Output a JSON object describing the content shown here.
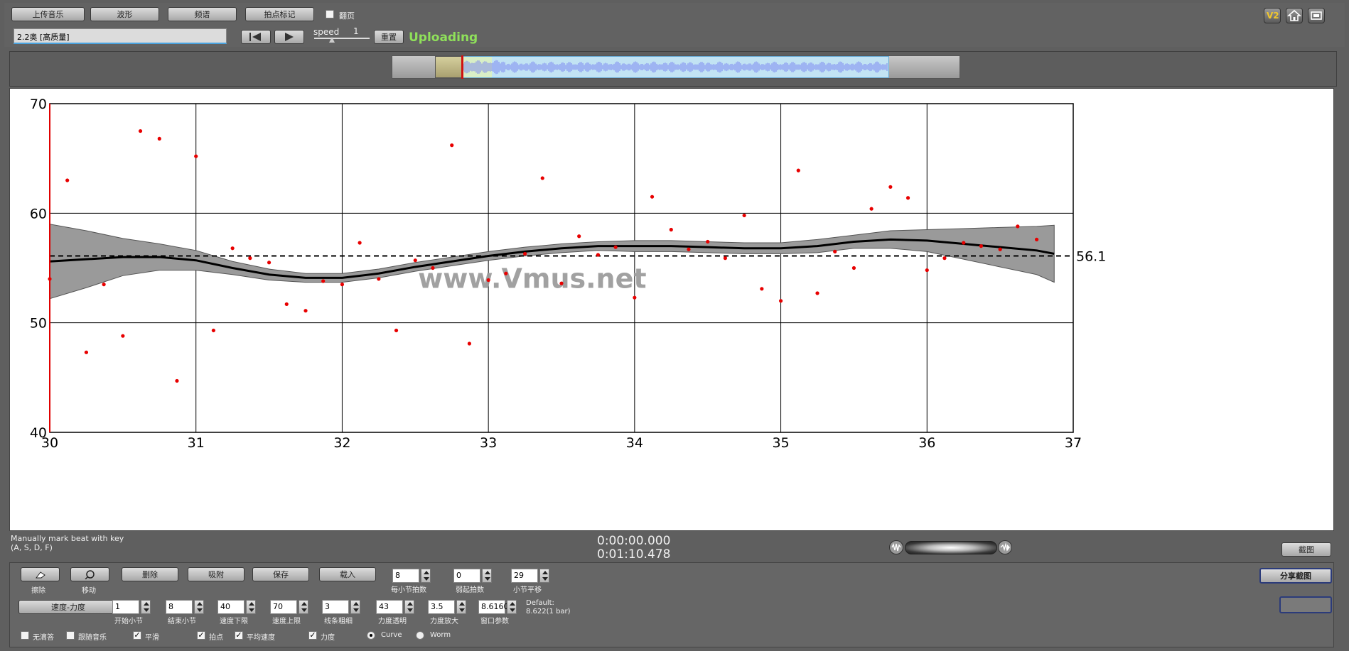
{
  "toolbar": {
    "upload_music": "上传音乐",
    "waveform": "波形",
    "spectrum": "频谱",
    "beat_mark": "拍点标记",
    "flip_label": "翻页",
    "file_name": "2.2奥 [高质量]",
    "speed_label": "speed",
    "speed_value": "1",
    "reset": "重置",
    "status": "Uploading"
  },
  "top_right_icons": [
    "v2-icon",
    "home-icon",
    "window-icon"
  ],
  "v2_label": "V2",
  "chart_data": {
    "type": "scatter",
    "x_ticks": [
      "30",
      "31",
      "32",
      "33",
      "34",
      "35",
      "36",
      "37"
    ],
    "y_ticks": [
      "40",
      "50",
      "60",
      "70"
    ],
    "xlim": [
      30,
      37
    ],
    "ylim": [
      40,
      70
    ],
    "grid": true,
    "watermark": "www.Vmus.net",
    "mean_value": 56.1,
    "mean_label": "56.1",
    "points": [
      [
        30.0,
        54.0
      ],
      [
        30.12,
        63.0
      ],
      [
        30.25,
        47.3
      ],
      [
        30.37,
        53.5
      ],
      [
        30.5,
        48.8
      ],
      [
        30.62,
        67.5
      ],
      [
        30.75,
        66.8
      ],
      [
        30.87,
        44.7
      ],
      [
        31.0,
        65.2
      ],
      [
        31.12,
        49.3
      ],
      [
        31.25,
        56.8
      ],
      [
        31.37,
        55.9
      ],
      [
        31.5,
        55.5
      ],
      [
        31.62,
        51.7
      ],
      [
        31.75,
        51.1
      ],
      [
        31.87,
        53.8
      ],
      [
        32.0,
        53.5
      ],
      [
        32.12,
        57.3
      ],
      [
        32.25,
        54.0
      ],
      [
        32.37,
        49.3
      ],
      [
        32.5,
        55.7
      ],
      [
        32.62,
        55.0
      ],
      [
        32.75,
        66.2
      ],
      [
        32.87,
        48.1
      ],
      [
        33.0,
        53.9
      ],
      [
        33.12,
        54.5
      ],
      [
        33.25,
        56.3
      ],
      [
        33.37,
        63.2
      ],
      [
        33.5,
        53.6
      ],
      [
        33.62,
        57.9
      ],
      [
        33.75,
        56.2
      ],
      [
        33.87,
        56.9
      ],
      [
        34.0,
        52.3
      ],
      [
        34.12,
        61.5
      ],
      [
        34.25,
        58.5
      ],
      [
        34.37,
        56.7
      ],
      [
        34.5,
        57.4
      ],
      [
        34.62,
        55.9
      ],
      [
        34.75,
        59.8
      ],
      [
        34.87,
        53.1
      ],
      [
        35.0,
        52.0
      ],
      [
        35.12,
        63.9
      ],
      [
        35.25,
        52.7
      ],
      [
        35.37,
        56.5
      ],
      [
        35.5,
        55.0
      ],
      [
        35.62,
        60.4
      ],
      [
        35.75,
        62.4
      ],
      [
        35.87,
        61.4
      ],
      [
        36.0,
        54.8
      ],
      [
        36.12,
        55.9
      ],
      [
        36.25,
        57.3
      ],
      [
        36.37,
        57.0
      ],
      [
        36.5,
        56.7
      ],
      [
        36.62,
        58.8
      ],
      [
        36.75,
        57.6
      ]
    ],
    "smooth_curve": [
      [
        30.0,
        55.6
      ],
      [
        30.25,
        55.8
      ],
      [
        30.5,
        56.0
      ],
      [
        30.75,
        56.0
      ],
      [
        31.0,
        55.7
      ],
      [
        31.25,
        55.0
      ],
      [
        31.5,
        54.4
      ],
      [
        31.75,
        54.1
      ],
      [
        32.0,
        54.1
      ],
      [
        32.25,
        54.5
      ],
      [
        32.5,
        55.1
      ],
      [
        32.75,
        55.6
      ],
      [
        33.0,
        56.1
      ],
      [
        33.25,
        56.5
      ],
      [
        33.5,
        56.8
      ],
      [
        33.75,
        57.0
      ],
      [
        34.0,
        57.0
      ],
      [
        34.25,
        57.0
      ],
      [
        34.5,
        56.9
      ],
      [
        34.75,
        56.8
      ],
      [
        35.0,
        56.8
      ],
      [
        35.25,
        57.0
      ],
      [
        35.5,
        57.4
      ],
      [
        35.75,
        57.6
      ],
      [
        36.0,
        57.5
      ],
      [
        36.25,
        57.2
      ],
      [
        36.5,
        56.9
      ],
      [
        36.75,
        56.6
      ],
      [
        36.87,
        56.3
      ]
    ],
    "band_upper": [
      [
        30.0,
        59.0
      ],
      [
        30.25,
        58.4
      ],
      [
        30.5,
        57.7
      ],
      [
        30.75,
        57.2
      ],
      [
        31.0,
        56.6
      ],
      [
        31.25,
        55.6
      ],
      [
        31.5,
        54.9
      ],
      [
        31.75,
        54.5
      ],
      [
        32.0,
        54.5
      ],
      [
        32.25,
        54.9
      ],
      [
        32.5,
        55.5
      ],
      [
        32.75,
        56.0
      ],
      [
        33.0,
        56.5
      ],
      [
        33.25,
        56.9
      ],
      [
        33.5,
        57.2
      ],
      [
        33.75,
        57.4
      ],
      [
        34.0,
        57.5
      ],
      [
        34.25,
        57.5
      ],
      [
        34.5,
        57.4
      ],
      [
        34.75,
        57.3
      ],
      [
        35.0,
        57.3
      ],
      [
        35.25,
        57.6
      ],
      [
        35.5,
        58.0
      ],
      [
        35.75,
        58.4
      ],
      [
        36.0,
        58.5
      ],
      [
        36.25,
        58.6
      ],
      [
        36.5,
        58.7
      ],
      [
        36.75,
        58.8
      ],
      [
        36.87,
        58.9
      ]
    ],
    "band_lower": [
      [
        30.0,
        52.2
      ],
      [
        30.25,
        53.2
      ],
      [
        30.5,
        54.3
      ],
      [
        30.75,
        54.8
      ],
      [
        31.0,
        54.8
      ],
      [
        31.25,
        54.4
      ],
      [
        31.5,
        53.9
      ],
      [
        31.75,
        53.7
      ],
      [
        32.0,
        53.7
      ],
      [
        32.25,
        54.1
      ],
      [
        32.5,
        54.7
      ],
      [
        32.75,
        55.2
      ],
      [
        33.0,
        55.7
      ],
      [
        33.25,
        56.1
      ],
      [
        33.5,
        56.4
      ],
      [
        33.75,
        56.6
      ],
      [
        34.0,
        56.5
      ],
      [
        34.25,
        56.5
      ],
      [
        34.5,
        56.4
      ],
      [
        34.75,
        56.3
      ],
      [
        35.0,
        56.3
      ],
      [
        35.25,
        56.4
      ],
      [
        35.5,
        56.8
      ],
      [
        35.75,
        56.8
      ],
      [
        36.0,
        56.5
      ],
      [
        36.25,
        55.8
      ],
      [
        36.5,
        55.1
      ],
      [
        36.75,
        54.4
      ],
      [
        36.87,
        53.7
      ]
    ]
  },
  "status_bar": {
    "hint_line1": "Manually mark beat with key",
    "hint_line2": "(A, S, D, F)",
    "time_current": "0:00:00.000",
    "time_total": "0:01:10.478",
    "screenshot": "截图"
  },
  "controls": {
    "eraser_label": "擦除",
    "move_label": "移动",
    "delete": "删除",
    "snap": "吸附",
    "save": "保存",
    "load": "载入",
    "tempo_dynamics": "速度-力度",
    "share_screenshot": "分享截图",
    "default_note_line1": "Default:",
    "default_note_line2": "8.622(1 bar)",
    "spinners_row1": [
      {
        "value": "8",
        "label": "每小节拍数"
      },
      {
        "value": "0",
        "label": "弱起拍数"
      },
      {
        "value": "29",
        "label": "小节平移"
      }
    ],
    "spinners_row2": [
      {
        "value": "1",
        "label": "开始小节"
      },
      {
        "value": "8",
        "label": "结束小节"
      },
      {
        "value": "40",
        "label": "速度下限"
      },
      {
        "value": "70",
        "label": "速度上限"
      },
      {
        "value": "3",
        "label": "线条粗细"
      },
      {
        "value": "43",
        "label": "力度透明"
      },
      {
        "value": "3.5",
        "label": "力度放大"
      },
      {
        "value": "8.6160",
        "label": "窗口参数"
      }
    ],
    "checks": [
      {
        "label": "无滴答",
        "checked": false
      },
      {
        "label": "跟随音乐",
        "checked": false
      },
      {
        "label": "平滑",
        "checked": true
      },
      {
        "label": "拍点",
        "checked": true
      },
      {
        "label": "平均速度",
        "checked": true
      },
      {
        "label": "力度",
        "checked": true
      }
    ],
    "radios": [
      {
        "label": "Curve",
        "selected": true
      },
      {
        "label": "Worm",
        "selected": false
      }
    ]
  }
}
